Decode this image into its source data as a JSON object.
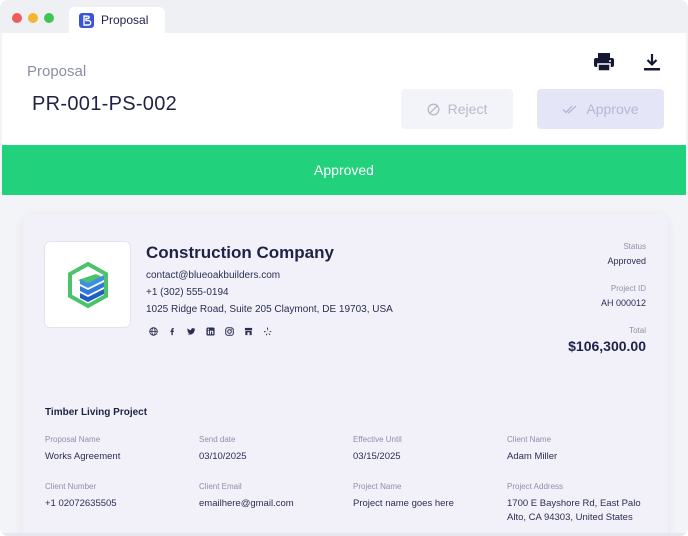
{
  "window": {
    "tab_title": "Proposal"
  },
  "header": {
    "kicker": "Proposal",
    "proposal_id": "PR-001-PS-002",
    "reject_label": "Reject",
    "approve_label": "Approve"
  },
  "banner": {
    "text": "Approved"
  },
  "company": {
    "name": "Construction Company",
    "email": "contact@blueoakbuilders.com",
    "phone": "+1 (302) 555-0194",
    "address": "1025 Ridge Road, Suite 205 Claymont, DE 19703, USA",
    "socials": [
      "globe-icon",
      "facebook-icon",
      "twitter-icon",
      "linkedin-icon",
      "instagram-icon",
      "store-icon",
      "yelp-icon"
    ]
  },
  "meta": {
    "status_label": "Status",
    "status_value": "Approved",
    "project_id_label": "Project ID",
    "project_id_value": "AH 000012",
    "total_label": "Total",
    "total_value": "$106,300.00"
  },
  "project": {
    "title": "Timber Living Project",
    "fields": [
      {
        "label": "Proposal Name",
        "value": "Works Agreement"
      },
      {
        "label": "Send date",
        "value": "03/10/2025"
      },
      {
        "label": "Effective Until",
        "value": "03/15/2025"
      },
      {
        "label": "Client Name",
        "value": "Adam Miller"
      },
      {
        "label": "Client Number",
        "value": "+1 02072635505"
      },
      {
        "label": "Client Email",
        "value": "emailhere@gmail.com"
      },
      {
        "label": "Project Name",
        "value": "Project name goes here"
      },
      {
        "label": "Project Address",
        "value": "1700 E Bayshore Rd, East Palo Alto, CA 94303, United States"
      }
    ]
  },
  "colors": {
    "banner_green": "#22d17c",
    "brand_blue": "#3a56d6",
    "logo_green": "#4cc26a",
    "logo_blue": "#2f7ad8"
  }
}
